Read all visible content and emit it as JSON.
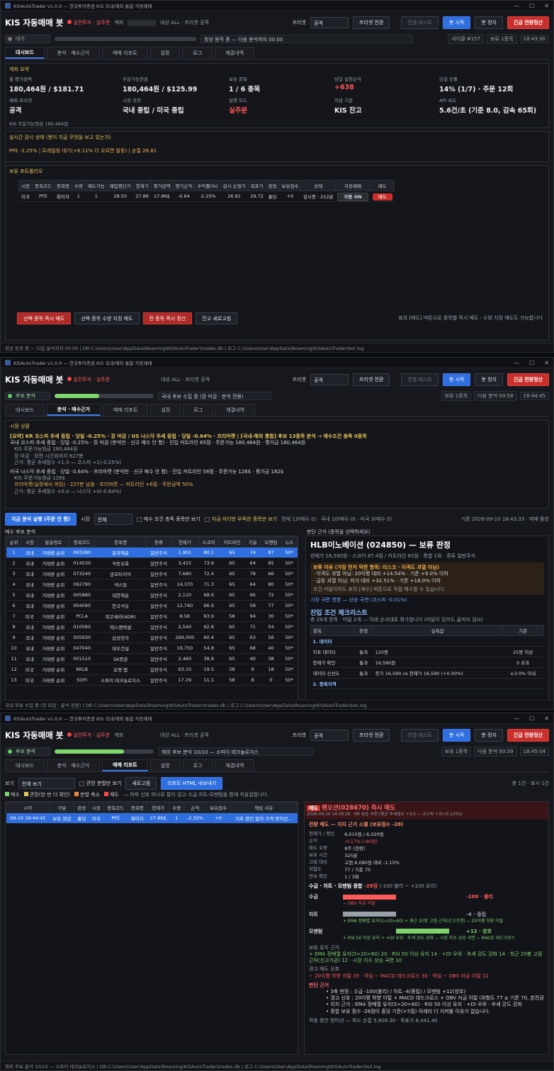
{
  "app": {
    "wtitle": "KISAutoTrader v1.0.0 — 한국투자증권 KIS 국내/해외 통합 자동매매",
    "title": "KIS 자동매매 봇",
    "mode": "실전투자 · 실주문",
    "account": "계좌",
    "target": "대상 ALL · 프리셋 공격",
    "preset_label": "프리셋",
    "preset": "공격",
    "preset_btn": "프리셋 전환",
    "conn_btn": "연결 테스트",
    "start_btn": "봇 시작",
    "stop_btn": "봇 정지",
    "panic_btn": "긴급 전량정산",
    "win_min": "—",
    "win_max": "☐",
    "win_close": "✕"
  },
  "tabs": [
    "대시보드",
    "분석 · 매수근거",
    "매매 리포트",
    "설정",
    "로그",
    "체결내역"
  ],
  "w1": {
    "badge": "대기",
    "progress": 0,
    "status": "정상 동작 중 — 다음 분석까지 00:00",
    "chips": [
      "사이클 #157",
      "보유 1종목",
      "18:43:30"
    ],
    "acct_h": "계좌 요약",
    "kv": [
      [
        "총 평가금액",
        "180,464원 / $181.71"
      ],
      [
        "주문가능현금",
        "180,464원 / $125.99"
      ],
      [
        "보유 종목",
        "1 / 6 종목"
      ],
      [
        "당일 실현손익",
        "+638"
      ],
      [
        "당일 승률",
        "14% (1/7) · 주문 12회"
      ],
      [
        "매매 프리셋",
        "공격"
      ],
      [
        "시장 국면",
        "국내 중립 / 미국 중립"
      ],
      [
        "실행 모드",
        "실주문"
      ],
      [
        "자금 기준",
        "KIS 잔고"
      ],
      [
        "API 속도",
        "5.6건/초 (기준 8.0, 감속 65회)"
      ]
    ],
    "kis_cash": "KIS 주문가능현금 180,464원",
    "watch_h": "실시간 감시 상태 (봇이 지금 무엇을 보고 있는가)",
    "watch": "PFE -2.25% | 트레일링 대기(+6.11% 더 오르면 발동) | 손절 26.81",
    "pf_h": "보유 포트폴리오",
    "pf_cols": [
      "시장",
      "종목코드",
      "종목명",
      "수량",
      "매도가능",
      "매입평단가",
      "현재가",
      "평가금액",
      "평가손익",
      "수익률(%)",
      "감시 손절가",
      "목표가",
      "판정",
      "보유점수",
      "상태",
      "자동매매",
      "매도"
    ],
    "pf_row": [
      "미국",
      "PFE",
      "화이자",
      "1",
      "1",
      "28.50",
      "27.86",
      "27.86$",
      "-0.64",
      "-2.25%",
      "26.81",
      "29.72",
      "홀딩",
      "+0",
      "감시중 · 212분",
      "자동 ON",
      "매도"
    ],
    "pf_btns": [
      "선택 종목 즉시 매도",
      "선택 종목 수량 지정 매도",
      "전 종목 즉시 정산",
      "잔고 새로고침"
    ],
    "pf_hint": "표의 [매도] 버튼으로 종목별 즉시 매도 · 수량 지정 매도도 가능합니다",
    "footer": "정상 동작 중 — 다음 분석까지 00:00  |  DB C:\\Users\\User\\AppData\\Roaming\\KISAutoTrader\\trades.db  |  로그 C:\\Users\\User\\AppData\\Roaming\\KISAutoTrader\\bot.log"
  },
  "w2": {
    "badge": "후보 분석",
    "progress": 45,
    "status": "국내 후보 수집 중 (장 마감 · 분석 전용)",
    "chips": [
      "보유 1종목",
      "다음 분석 00:58",
      "18:44:45"
    ],
    "mk_h": "시장 상황",
    "summary": "[요약] KR 코스피 추세 중립 · 당일 -0.25% · 장 마감 / US 나스닥 추세 중립 · 당일 -0.64% · 프리마켓 | [국내-해외 통합] 후보 13종목 분석 → 매수조건 충족 0종목",
    "kr": [
      "국내 코스피 추세 중립 · 당일 -0.25% · 장 마감 (분석만 · 신규 매수 안 함) · 진입 커트라인 65점 · 주문가능 180,464원 · 평가금 180,464원",
      "KIS 주문가능현금 180,464원",
      "장 마감 · 장전 시간외까지 827분",
      "근거: 평균 추세점수 +1.0 — 코스피 +1(-0.25%)"
    ],
    "us": [
      "미국 나스닥 추세 중립 · 당일 -0.64% · 프리마켓 (분석만 · 신규 매수 안 함) · 진입 커트라인 58점 · 주문가능 126$ · 평가금 182$",
      "KIS 주문가능현금 126$",
      "프리마켓(실정에서 꺼짐) · 227분 남음 · 프리마켓 — 커트라인 +6점 · 주문금액 50%",
      "근거: 평균 추세점수 +0.0 — 나스닥 +0(-0.64%)"
    ],
    "run_btn": "지금 분석 실행 (주문 안 함)",
    "mkt_label": "시장",
    "mkt": "전체",
    "cb1": "매수 조건 충족 종목만 보기",
    "cb2": "자금·자리만 부족한 종목만 보기",
    "counts": "전체 13(매수 0) · 국내 10(매수 0) · 미국 3(매수 0)",
    "ts": "기준 2026-09-10 18:43:33 · 매매 활성",
    "cand_h": "매수 후보 분석",
    "detail_h": "판단 근거 (종목을 선택하세요)",
    "cand_cols": [
      "순위",
      "시장",
      "발굴경로",
      "종목코드",
      "종목명",
      "종류",
      "현재가",
      "스코어",
      "커트라인",
      "기술",
      "모멘텀",
      "뉴스"
    ],
    "cand_rows": [
      [
        "1",
        "국내",
        "거래량 순위",
        "003280",
        "흥아해운",
        "일반주식",
        "1,901",
        "80.1",
        "65",
        "74",
        "87",
        "50*"
      ],
      [
        "2",
        "국내",
        "거래량 순위",
        "014530",
        "극동유화",
        "일반주식",
        "3,415",
        "73.9",
        "65",
        "64",
        "85",
        "50*"
      ],
      [
        "3",
        "국내",
        "거래량 순위",
        "073240",
        "금호타이어",
        "일반주식",
        "7,680",
        "72.4",
        "65",
        "78",
        "66",
        "50*"
      ],
      [
        "4",
        "국내",
        "거래량 순위",
        "092790",
        "넥스틸",
        "일반주식",
        "14,370",
        "71.3",
        "65",
        "64",
        "80",
        "50*"
      ],
      [
        "5",
        "국내",
        "거래량 순위",
        "005880",
        "대한해운",
        "일반주식",
        "2,110",
        "68.6",
        "65",
        "66",
        "72",
        "50*"
      ],
      [
        "6",
        "국내",
        "거래량 순위",
        "004090",
        "한국석유",
        "일반주식",
        "12,740",
        "66.9",
        "65",
        "58",
        "77",
        "50*"
      ],
      [
        "7",
        "미국",
        "거래량 순위",
        "PCLA",
        "피코세라(ADR)",
        "일반주식",
        "8.58",
        "63.9",
        "58",
        "94",
        "30",
        "50*"
      ],
      [
        "8",
        "국내",
        "거래량 순위",
        "010580",
        "에스엠벡셀",
        "일반주식",
        "2,540",
        "62.8",
        "65",
        "71",
        "54",
        "50*"
      ],
      [
        "9",
        "국내",
        "거래량 순위",
        "005930",
        "삼성전자",
        "일반주식",
        "269,000",
        "60.4",
        "65",
        "63",
        "56",
        "50*"
      ],
      [
        "10",
        "국내",
        "거래량 순위",
        "047040",
        "대우건설",
        "일반주식",
        "19,750",
        "54.8",
        "65",
        "68",
        "40",
        "50*"
      ],
      [
        "11",
        "국내",
        "거래량 순위",
        "001510",
        "SK증권",
        "일반주식",
        "2,460",
        "38.8",
        "65",
        "40",
        "38",
        "50*"
      ],
      [
        "12",
        "미국",
        "거래량 순위",
        "RKLB",
        "로켓 랩",
        "일반주식",
        "63.10",
        "19.5",
        "58",
        "8",
        "18",
        "50*"
      ],
      [
        "13",
        "미국",
        "거래량 순위",
        "SOFI",
        "소파이 테크놀로지스",
        "일반주식",
        "17.29",
        "11.1",
        "58",
        "8",
        "0",
        "50*"
      ]
    ],
    "d_title": "HLB이노베이션 (024850) — 보류 판정",
    "d_sub": "현재가 16,590원 · 스코어 87.4점 / 커트라인 65점 · 통합 1위 · 종류 일반주식",
    "d_warn": [
      "보류 이유 (가장 먼저 막힌 항목: 리스크 · 이격도 과열 아님)",
      "· 이격도 과열 아님: 20이평 대비 +14.54% · 기준 +9.0% 이하",
      "· 급등 과열 아님: 저가 대비 +32.51% · 기준 +18.0% 이하",
      "조건 미달이어도 표의 [매수] 버튼으로 직접 매수할 수 있습니다."
    ],
    "d_regime": "시장 국면 영향 — 상승 국면 (코스피 -0.01%)",
    "d_check_h": "진입 조건 체크리스트",
    "d_check_sub": "총 29개 항목 · 미달 2개 — 아래 순서대로 평가합니다 (미달이 있어도 끝까지 검사)",
    "d_check_cols": [
      "항목",
      "판정",
      "실측값",
      "기준"
    ],
    "d_group": "1. 데이터",
    "d_rows": [
      [
        "지표 데이터",
        "통과",
        "120봉",
        "25봉 이상"
      ],
      [
        "현재가 확인",
        "통과",
        "16,590원",
        "0 초과"
      ],
      [
        "데이터 신선도",
        "통과",
        "종가 16,590 vs 현재가 16,590 (+0.00%)",
        "±3.0% 이내"
      ]
    ],
    "d_group2": "2. 종목자격",
    "footer": "국내 후보 수집 중 (장 마감 · 분석 전용)  |  DB C:\\Users\\User\\AppData\\Roaming\\KISAutoTrader\\trades.db  |  로그 C:\\Users\\User\\AppData\\Roaming\\KISAutoTrader\\bot.log"
  },
  "w3": {
    "badge": "후보 분석",
    "progress": 70,
    "status": "해외 후보 분석 10/10 — 소파이 테크놀로지스",
    "chips": [
      "보유 1종목",
      "다음 분석 00:39",
      "18:45:04"
    ],
    "view_label": "보기",
    "view": "전체 보기",
    "cb": "관망 분할만 보기",
    "refresh_btn": "새로고침",
    "export_btn": "리포트 HTML 내보내기",
    "count": "총 1건 · 표시 1건",
    "legend": [
      "매수",
      "관망(한 번 더 확인)",
      "분할 축소",
      "매도"
    ],
    "legend_note": "— 하락 신호 하나로 팔지 않고 수급·차트·모멘텀을 함께 저울질합니다.",
    "cols": [
      "시각",
      "구분",
      "판정",
      "시장",
      "종목코드",
      "종목명",
      "현재가",
      "수량",
      "손익",
      "보유점수",
      "핵심 사유"
    ],
    "row": [
      "09-10 18:44:45",
      "보유 점검",
      "홀딩",
      "미국",
      "PFE",
      "화이자",
      "27.86$",
      "1",
      "-2.32%",
      "+0",
      "지표 판단 없이 가격 방어선..."
    ],
    "r_tag": "매도",
    "r_title": "팬오션(028670) 즉시 매도",
    "r_meta": "2026-09-10 14:58:39 · KR 상승 국면 (평균 추세점수 +3.0 — 코스피 +3(+0.13%))",
    "r_sum": "전량 매도 — 지지 근거 소멸 (보유점수 -28)",
    "r_kv": [
      [
        "현재가 / 평단",
        "6,010원 / 6,020원"
      ],
      [
        "손익",
        "-0.17% (-80원)"
      ],
      [
        "매도 수량",
        "8주 (전량)"
      ],
      [
        "보유 시간",
        "325분"
      ],
      [
        "고점 대비",
        "고점 6,080원 대비 -1.15%"
      ],
      [
        "위험도",
        "77 / 기준 70"
      ],
      [
        "연속 확인",
        "1 / 3회"
      ]
    ],
    "r_score_h": "수급 · 차트 · 모멘텀 종합",
    "r_score": "-28점",
    "r_score_rng": "(-100 불리 ~ +100 유리)",
    "r_bars": [
      {
        "name": "수급",
        "value": -100,
        "label": "-100 · 불리",
        "note": "− OBV 자금 이탈"
      },
      {
        "name": "차트",
        "value": -4,
        "label": "-4 · 중립",
        "note": "+ EMA 정배열 유지(5>20>60) + 최근 20봉 고점 근처(신고가권) − 20이평 하향 이탈"
      },
      {
        "name": "모멘텀",
        "value": 12,
        "label": "+12 · 양호",
        "note": "+ RSI 50 이상 유지 + +DI 우위 · 추세 강도 강화 − 시장 지수 상승 국면 − MACD 데드크로스"
      }
    ],
    "r_keep_h": "보유 유지 근거",
    "r_keep": "+ EMA 정배열 유지(5>20>60) 20 · RSI 50 이상 유지 14 · +DI 우위 · 추세 강도 강화 14 · 최근 20봉 고점 근처(신고가권) 12 · 시장 지수 상승 국면 10",
    "r_warn_h": "경고 매도 신호",
    "r_warn": "− 20이평 하향 이탈 35 · 약심 − MACD 데드크로스 30 · 약심 − OBV 자금 이탈 12",
    "r_basis_h": "판단 근거",
    "r_basis": [
      "• 3축 판정 : 수급 -100(불리) / 차트 -4(중립) / 모멘텀 +12(양호)",
      "• 경고 신호 : 20이평 하향 이탈 + MACD 데드크로스 + OBV 자금 이탈 (위험도 77 ≥ 기준 70, 본전권)",
      "• 지지 근거 : EMA 정배열 유지(5>20>60) · RSI 50 이상 유지 · +DI 우위 · 추세 강도 강화",
      "• 종합 보유 점수 -28점이 홀딩 기준(+5점) 아래라 더 지켜볼 이유가 없습니다."
    ],
    "r_foot": "작동 중인 방어선 — 하드 손절 5,809.30 · 목표가 6,441.40",
    "footer": "해외 후보 분석 10/10 — 소파이 테크놀로지스  |  DB C:\\Users\\User\\AppData\\Roaming\\KISAutoTrader\\trades.db  |  로그 C:\\Users\\User\\AppData\\Roaming\\KISAutoTrader\\bot.log"
  },
  "colors": {
    "accent": "#2f6fe0",
    "danger": "#c9302c",
    "up": "#ff5656",
    "down": "#6aa8ff",
    "ok": "#7ed36a",
    "warn": "#e8c65a"
  }
}
